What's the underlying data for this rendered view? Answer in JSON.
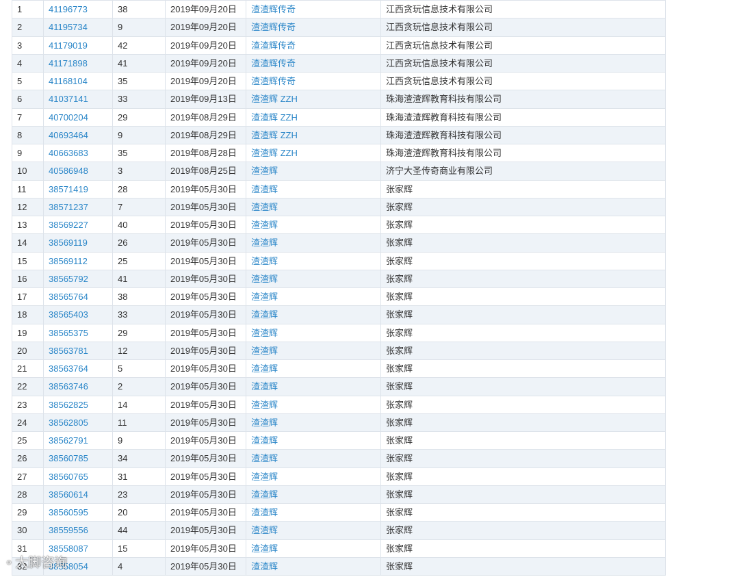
{
  "rows": [
    {
      "index": "1",
      "reg_no": "41196773",
      "class": "38",
      "date": "2019年09月20日",
      "name": "渣渣辉传奇",
      "applicant": "江西贪玩信息技术有限公司"
    },
    {
      "index": "2",
      "reg_no": "41195734",
      "class": "9",
      "date": "2019年09月20日",
      "name": "渣渣辉传奇",
      "applicant": "江西贪玩信息技术有限公司"
    },
    {
      "index": "3",
      "reg_no": "41179019",
      "class": "42",
      "date": "2019年09月20日",
      "name": "渣渣辉传奇",
      "applicant": "江西贪玩信息技术有限公司"
    },
    {
      "index": "4",
      "reg_no": "41171898",
      "class": "41",
      "date": "2019年09月20日",
      "name": "渣渣辉传奇",
      "applicant": "江西贪玩信息技术有限公司"
    },
    {
      "index": "5",
      "reg_no": "41168104",
      "class": "35",
      "date": "2019年09月20日",
      "name": "渣渣辉传奇",
      "applicant": "江西贪玩信息技术有限公司"
    },
    {
      "index": "6",
      "reg_no": "41037141",
      "class": "33",
      "date": "2019年09月13日",
      "name": "渣渣辉 ZZH",
      "applicant": "珠海渣渣辉教育科技有限公司"
    },
    {
      "index": "7",
      "reg_no": "40700204",
      "class": "29",
      "date": "2019年08月29日",
      "name": "渣渣辉 ZZH",
      "applicant": "珠海渣渣辉教育科技有限公司"
    },
    {
      "index": "8",
      "reg_no": "40693464",
      "class": "9",
      "date": "2019年08月29日",
      "name": "渣渣辉 ZZH",
      "applicant": "珠海渣渣辉教育科技有限公司"
    },
    {
      "index": "9",
      "reg_no": "40663683",
      "class": "35",
      "date": "2019年08月28日",
      "name": "渣渣辉 ZZH",
      "applicant": "珠海渣渣辉教育科技有限公司"
    },
    {
      "index": "10",
      "reg_no": "40586948",
      "class": "3",
      "date": "2019年08月25日",
      "name": "渣渣辉",
      "applicant": "济宁大圣传奇商业有限公司"
    },
    {
      "index": "11",
      "reg_no": "38571419",
      "class": "28",
      "date": "2019年05月30日",
      "name": "渣渣辉",
      "applicant": "张家辉"
    },
    {
      "index": "12",
      "reg_no": "38571237",
      "class": "7",
      "date": "2019年05月30日",
      "name": "渣渣辉",
      "applicant": "张家辉"
    },
    {
      "index": "13",
      "reg_no": "38569227",
      "class": "40",
      "date": "2019年05月30日",
      "name": "渣渣辉",
      "applicant": "张家辉"
    },
    {
      "index": "14",
      "reg_no": "38569119",
      "class": "26",
      "date": "2019年05月30日",
      "name": "渣渣辉",
      "applicant": "张家辉"
    },
    {
      "index": "15",
      "reg_no": "38569112",
      "class": "25",
      "date": "2019年05月30日",
      "name": "渣渣辉",
      "applicant": "张家辉"
    },
    {
      "index": "16",
      "reg_no": "38565792",
      "class": "41",
      "date": "2019年05月30日",
      "name": "渣渣辉",
      "applicant": "张家辉"
    },
    {
      "index": "17",
      "reg_no": "38565764",
      "class": "38",
      "date": "2019年05月30日",
      "name": "渣渣辉",
      "applicant": "张家辉"
    },
    {
      "index": "18",
      "reg_no": "38565403",
      "class": "33",
      "date": "2019年05月30日",
      "name": "渣渣辉",
      "applicant": "张家辉"
    },
    {
      "index": "19",
      "reg_no": "38565375",
      "class": "29",
      "date": "2019年05月30日",
      "name": "渣渣辉",
      "applicant": "张家辉"
    },
    {
      "index": "20",
      "reg_no": "38563781",
      "class": "12",
      "date": "2019年05月30日",
      "name": "渣渣辉",
      "applicant": "张家辉"
    },
    {
      "index": "21",
      "reg_no": "38563764",
      "class": "5",
      "date": "2019年05月30日",
      "name": "渣渣辉",
      "applicant": "张家辉"
    },
    {
      "index": "22",
      "reg_no": "38563746",
      "class": "2",
      "date": "2019年05月30日",
      "name": "渣渣辉",
      "applicant": "张家辉"
    },
    {
      "index": "23",
      "reg_no": "38562825",
      "class": "14",
      "date": "2019年05月30日",
      "name": "渣渣辉",
      "applicant": "张家辉"
    },
    {
      "index": "24",
      "reg_no": "38562805",
      "class": "11",
      "date": "2019年05月30日",
      "name": "渣渣辉",
      "applicant": "张家辉"
    },
    {
      "index": "25",
      "reg_no": "38562791",
      "class": "9",
      "date": "2019年05月30日",
      "name": "渣渣辉",
      "applicant": "张家辉"
    },
    {
      "index": "26",
      "reg_no": "38560785",
      "class": "34",
      "date": "2019年05月30日",
      "name": "渣渣辉",
      "applicant": "张家辉"
    },
    {
      "index": "27",
      "reg_no": "38560765",
      "class": "31",
      "date": "2019年05月30日",
      "name": "渣渣辉",
      "applicant": "张家辉"
    },
    {
      "index": "28",
      "reg_no": "38560614",
      "class": "23",
      "date": "2019年05月30日",
      "name": "渣渣辉",
      "applicant": "张家辉"
    },
    {
      "index": "29",
      "reg_no": "38560595",
      "class": "20",
      "date": "2019年05月30日",
      "name": "渣渣辉",
      "applicant": "张家辉"
    },
    {
      "index": "30",
      "reg_no": "38559556",
      "class": "44",
      "date": "2019年05月30日",
      "name": "渣渣辉",
      "applicant": "张家辉"
    },
    {
      "index": "31",
      "reg_no": "38558087",
      "class": "15",
      "date": "2019年05月30日",
      "name": "渣渣辉",
      "applicant": "张家辉"
    },
    {
      "index": "32",
      "reg_no": "38558054",
      "class": "4",
      "date": "2019年05月30日",
      "name": "渣渣辉",
      "applicant": "张家辉"
    }
  ],
  "watermark": {
    "icon": "camera-lens-icon",
    "text": "大脚咨询"
  },
  "colors": {
    "link": "#2a86c8",
    "row_alt": "#eef3f8",
    "border": "#dde3ea",
    "text": "#333333"
  }
}
